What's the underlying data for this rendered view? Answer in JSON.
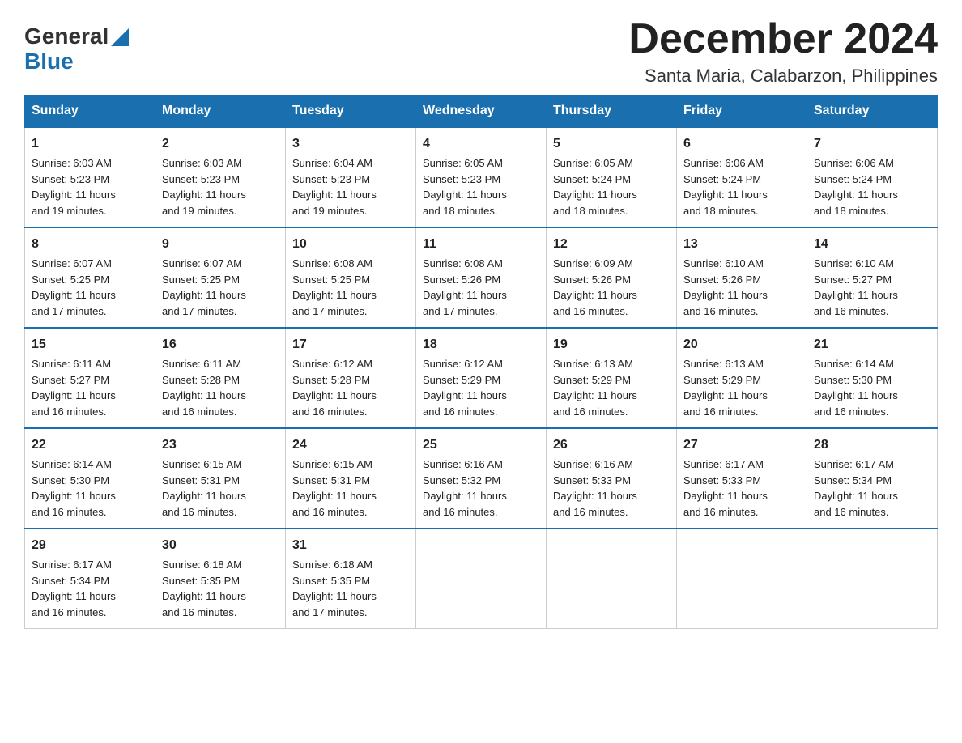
{
  "header": {
    "logo": {
      "general": "General",
      "blue": "Blue"
    },
    "title": "December 2024",
    "subtitle": "Santa Maria, Calabarzon, Philippines"
  },
  "days_of_week": [
    "Sunday",
    "Monday",
    "Tuesday",
    "Wednesday",
    "Thursday",
    "Friday",
    "Saturday"
  ],
  "weeks": [
    [
      {
        "day": "1",
        "sunrise": "6:03 AM",
        "sunset": "5:23 PM",
        "daylight": "11 hours and 19 minutes."
      },
      {
        "day": "2",
        "sunrise": "6:03 AM",
        "sunset": "5:23 PM",
        "daylight": "11 hours and 19 minutes."
      },
      {
        "day": "3",
        "sunrise": "6:04 AM",
        "sunset": "5:23 PM",
        "daylight": "11 hours and 19 minutes."
      },
      {
        "day": "4",
        "sunrise": "6:05 AM",
        "sunset": "5:23 PM",
        "daylight": "11 hours and 18 minutes."
      },
      {
        "day": "5",
        "sunrise": "6:05 AM",
        "sunset": "5:24 PM",
        "daylight": "11 hours and 18 minutes."
      },
      {
        "day": "6",
        "sunrise": "6:06 AM",
        "sunset": "5:24 PM",
        "daylight": "11 hours and 18 minutes."
      },
      {
        "day": "7",
        "sunrise": "6:06 AM",
        "sunset": "5:24 PM",
        "daylight": "11 hours and 18 minutes."
      }
    ],
    [
      {
        "day": "8",
        "sunrise": "6:07 AM",
        "sunset": "5:25 PM",
        "daylight": "11 hours and 17 minutes."
      },
      {
        "day": "9",
        "sunrise": "6:07 AM",
        "sunset": "5:25 PM",
        "daylight": "11 hours and 17 minutes."
      },
      {
        "day": "10",
        "sunrise": "6:08 AM",
        "sunset": "5:25 PM",
        "daylight": "11 hours and 17 minutes."
      },
      {
        "day": "11",
        "sunrise": "6:08 AM",
        "sunset": "5:26 PM",
        "daylight": "11 hours and 17 minutes."
      },
      {
        "day": "12",
        "sunrise": "6:09 AM",
        "sunset": "5:26 PM",
        "daylight": "11 hours and 16 minutes."
      },
      {
        "day": "13",
        "sunrise": "6:10 AM",
        "sunset": "5:26 PM",
        "daylight": "11 hours and 16 minutes."
      },
      {
        "day": "14",
        "sunrise": "6:10 AM",
        "sunset": "5:27 PM",
        "daylight": "11 hours and 16 minutes."
      }
    ],
    [
      {
        "day": "15",
        "sunrise": "6:11 AM",
        "sunset": "5:27 PM",
        "daylight": "11 hours and 16 minutes."
      },
      {
        "day": "16",
        "sunrise": "6:11 AM",
        "sunset": "5:28 PM",
        "daylight": "11 hours and 16 minutes."
      },
      {
        "day": "17",
        "sunrise": "6:12 AM",
        "sunset": "5:28 PM",
        "daylight": "11 hours and 16 minutes."
      },
      {
        "day": "18",
        "sunrise": "6:12 AM",
        "sunset": "5:29 PM",
        "daylight": "11 hours and 16 minutes."
      },
      {
        "day": "19",
        "sunrise": "6:13 AM",
        "sunset": "5:29 PM",
        "daylight": "11 hours and 16 minutes."
      },
      {
        "day": "20",
        "sunrise": "6:13 AM",
        "sunset": "5:29 PM",
        "daylight": "11 hours and 16 minutes."
      },
      {
        "day": "21",
        "sunrise": "6:14 AM",
        "sunset": "5:30 PM",
        "daylight": "11 hours and 16 minutes."
      }
    ],
    [
      {
        "day": "22",
        "sunrise": "6:14 AM",
        "sunset": "5:30 PM",
        "daylight": "11 hours and 16 minutes."
      },
      {
        "day": "23",
        "sunrise": "6:15 AM",
        "sunset": "5:31 PM",
        "daylight": "11 hours and 16 minutes."
      },
      {
        "day": "24",
        "sunrise": "6:15 AM",
        "sunset": "5:31 PM",
        "daylight": "11 hours and 16 minutes."
      },
      {
        "day": "25",
        "sunrise": "6:16 AM",
        "sunset": "5:32 PM",
        "daylight": "11 hours and 16 minutes."
      },
      {
        "day": "26",
        "sunrise": "6:16 AM",
        "sunset": "5:33 PM",
        "daylight": "11 hours and 16 minutes."
      },
      {
        "day": "27",
        "sunrise": "6:17 AM",
        "sunset": "5:33 PM",
        "daylight": "11 hours and 16 minutes."
      },
      {
        "day": "28",
        "sunrise": "6:17 AM",
        "sunset": "5:34 PM",
        "daylight": "11 hours and 16 minutes."
      }
    ],
    [
      {
        "day": "29",
        "sunrise": "6:17 AM",
        "sunset": "5:34 PM",
        "daylight": "11 hours and 16 minutes."
      },
      {
        "day": "30",
        "sunrise": "6:18 AM",
        "sunset": "5:35 PM",
        "daylight": "11 hours and 16 minutes."
      },
      {
        "day": "31",
        "sunrise": "6:18 AM",
        "sunset": "5:35 PM",
        "daylight": "11 hours and 17 minutes."
      },
      null,
      null,
      null,
      null
    ]
  ],
  "labels": {
    "sunrise": "Sunrise:",
    "sunset": "Sunset:",
    "daylight": "Daylight:"
  }
}
